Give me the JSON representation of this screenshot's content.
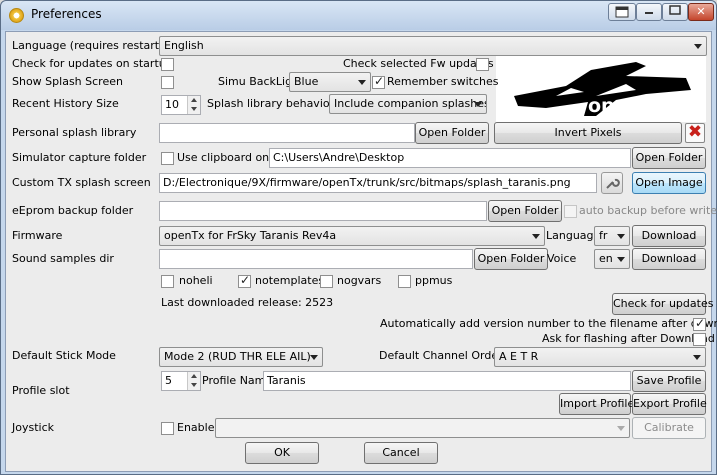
{
  "window": {
    "title": "Preferences"
  },
  "labels": {
    "language": "Language (requires restart)",
    "check_updates": "Check for updates on startup",
    "check_fw": "Check selected Fw updates",
    "show_splash": "Show Splash Screen",
    "simu_backlight": "Simu BackLight",
    "remember_switches": "Remember switches",
    "recent_history": "Recent History Size",
    "splash_behaviour": "Splash library behaviour",
    "personal_splash": "Personal splash library",
    "simulator_capture": "Simulator capture folder",
    "use_clipboard": "Use clipboard only",
    "custom_tx_splash": "Custom TX splash screen",
    "eeprom_backup": "eEprom backup folder",
    "auto_backup": "auto backup before write",
    "firmware": "Firmware",
    "fw_language": "Language",
    "sound_samples": "Sound samples dir",
    "voice": "Voice",
    "noheli": "noheli",
    "notemplates": "notemplates",
    "nogvars": "nogvars",
    "ppmus": "ppmus",
    "last_downloaded": "Last downloaded release: 2523",
    "auto_version": "Automatically add version number to the filename after download",
    "ask_flashing": "Ask for flashing after Download",
    "default_stick": "Default Stick Mode",
    "default_channel": "Default Channel Order",
    "profile_slot": "Profile slot",
    "profile_name": "Profile Name",
    "joystick": "Joystick",
    "enable": "Enable"
  },
  "values": {
    "language": "English",
    "simu_backlight": "Blue",
    "recent_history": "10",
    "splash_behaviour": "Include companion splashes",
    "personal_splash": "",
    "simulator_capture": "C:\\Users\\Andre\\Desktop",
    "custom_tx_splash": "D:/Electronique/9X/firmware/openTx/trunk/src/bitmaps/splash_taranis.png",
    "eeprom_backup": "",
    "firmware": "openTx for FrSky Taranis Rev4a",
    "fw_language": "fr",
    "sound_samples": "",
    "voice": "en",
    "default_stick": "Mode 2 (RUD THR ELE AIL)",
    "default_channel": "A E T R",
    "profile_slot": "5",
    "profile_name": "Taranis",
    "joystick": ""
  },
  "checkboxes": {
    "check_updates": false,
    "check_fw": false,
    "show_splash": false,
    "remember_switches": true,
    "use_clipboard": false,
    "auto_backup": false,
    "noheli": false,
    "notemplates": true,
    "nogvars": false,
    "ppmus": false,
    "auto_version": true,
    "ask_flashing": false,
    "joystick_enable": false
  },
  "buttons": {
    "open_folder": "Open Folder",
    "invert_pixels": "Invert Pixels",
    "open_image": "Open Image",
    "download": "Download",
    "check_for_updates": "Check for updates",
    "save_profile": "Save Profile",
    "import_profile": "Import Profile",
    "export_profile": "Export Profile",
    "calibrate": "Calibrate",
    "ok": "OK",
    "cancel": "Cancel"
  },
  "splash_logo": "openTx",
  "icons": {
    "app": "opentx-app-icon",
    "clear": "red-x-icon",
    "tool": "wrench-icon"
  },
  "colors": {
    "title_bar": "#c5d7ec",
    "close": "#c4452c"
  }
}
